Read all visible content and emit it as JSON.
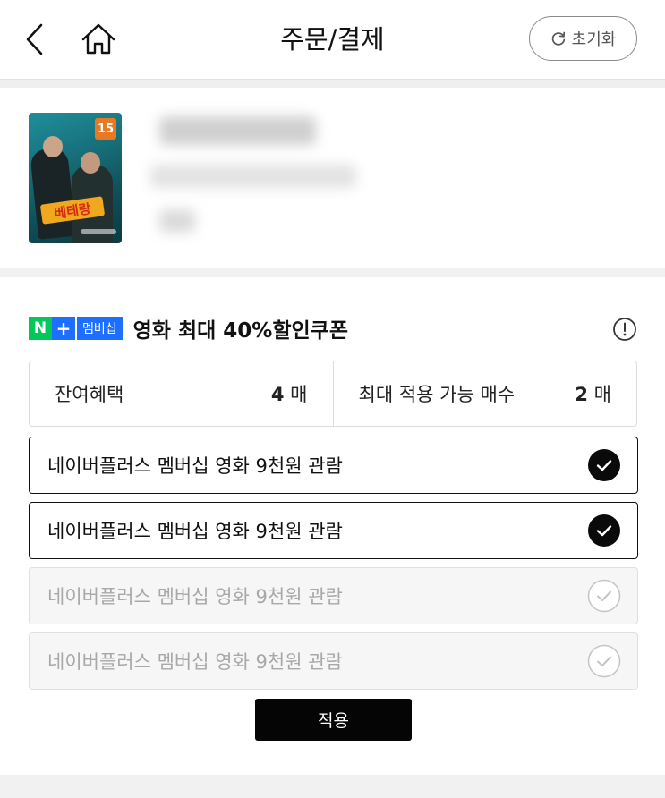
{
  "header": {
    "title": "주문/결제",
    "reset_label": "초기화",
    "back_icon": "chevron-left-icon",
    "home_icon": "home-icon",
    "reset_icon": "refresh-icon"
  },
  "movie": {
    "age_rating": "15",
    "poster_title": "베테랑"
  },
  "coupon": {
    "badge": {
      "n": "N",
      "plus": "+",
      "membership": "멤버십"
    },
    "title": "영화 최대 40%할인쿠폰",
    "info_icon": "info-circle-icon",
    "summary": [
      {
        "label": "잔여혜택",
        "value": "4",
        "unit": "매"
      },
      {
        "label": "최대 적용 가능 매수",
        "value": "2",
        "unit": "매"
      }
    ],
    "items": [
      {
        "label": "네이버플러스 멤버십 영화 9천원 관람",
        "selected": true
      },
      {
        "label": "네이버플러스 멤버십 영화 9천원 관람",
        "selected": true
      },
      {
        "label": "네이버플러스 멤버십 영화 9천원 관람",
        "selected": false
      },
      {
        "label": "네이버플러스 멤버십 영화 9천원 관람",
        "selected": false
      }
    ],
    "apply_label": "적용"
  },
  "colors": {
    "naver_green": "#03c75a",
    "plus_blue": "#1e6fff",
    "age_badge": "#e97823",
    "apply_button": "#050505"
  }
}
